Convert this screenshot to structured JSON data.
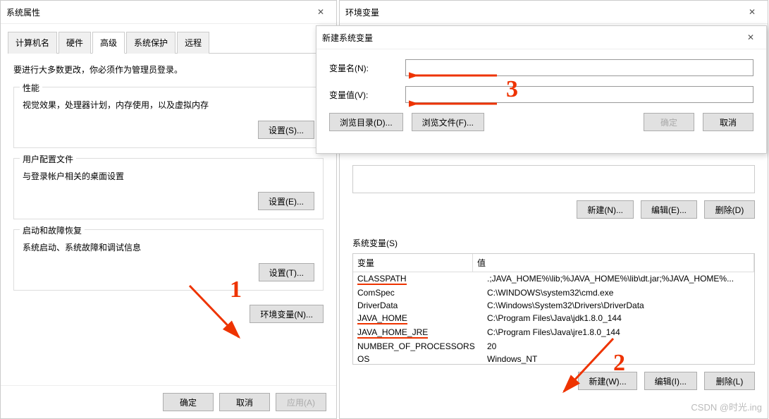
{
  "sysProps": {
    "title": "系统属性",
    "tabs": [
      "计算机名",
      "硬件",
      "高级",
      "系统保护",
      "远程"
    ],
    "activeTab": 2,
    "adminNote": "要进行大多数更改，你必须作为管理员登录。",
    "perf": {
      "legend": "性能",
      "desc": "视觉效果，处理器计划，内存使用，以及虚拟内存",
      "btn": "设置(S)..."
    },
    "profile": {
      "legend": "用户配置文件",
      "desc": "与登录帐户相关的桌面设置",
      "btn": "设置(E)..."
    },
    "startup": {
      "legend": "启动和故障恢复",
      "desc": "系统启动、系统故障和调试信息",
      "btn": "设置(T)..."
    },
    "envBtn": "环境变量(N)...",
    "ok": "确定",
    "cancel": "取消",
    "apply": "应用(A)"
  },
  "envVars": {
    "title": "环境变量",
    "sysSection": "系统变量(S)",
    "headers": {
      "name": "变量",
      "value": "值"
    },
    "userBtns": {
      "new": "新建(N)...",
      "edit": "编辑(E)...",
      "del": "删除(D)"
    },
    "sysBtns": {
      "new": "新建(W)...",
      "edit": "编辑(I)...",
      "del": "删除(L)"
    },
    "rows": [
      {
        "name": "CLASSPATH",
        "value": ".;JAVA_HOME%\\lib;%JAVA_HOME%\\lib\\dt.jar;%JAVA_HOME%...",
        "ul": true
      },
      {
        "name": "ComSpec",
        "value": "C:\\WINDOWS\\system32\\cmd.exe"
      },
      {
        "name": "DriverData",
        "value": "C:\\Windows\\System32\\Drivers\\DriverData"
      },
      {
        "name": "JAVA_HOME",
        "value": "C:\\Program Files\\Java\\jdk1.8.0_144",
        "ul": true
      },
      {
        "name": "JAVA_HOME_JRE",
        "value": "C:\\Program Files\\Java\\jre1.8.0_144",
        "ul": true
      },
      {
        "name": "NUMBER_OF_PROCESSORS",
        "value": "20"
      },
      {
        "name": "OS",
        "value": "Windows_NT"
      }
    ]
  },
  "newSysVar": {
    "title": "新建系统变量",
    "nameLabel": "变量名(N):",
    "valueLabel": "变量值(V):",
    "nameVal": "",
    "valueVal": "",
    "browseDir": "浏览目录(D)...",
    "browseFile": "浏览文件(F)...",
    "ok": "确定",
    "cancel": "取消"
  },
  "annotations": {
    "one": "1",
    "two": "2",
    "three": "3"
  },
  "watermark": "CSDN @时光.ing"
}
